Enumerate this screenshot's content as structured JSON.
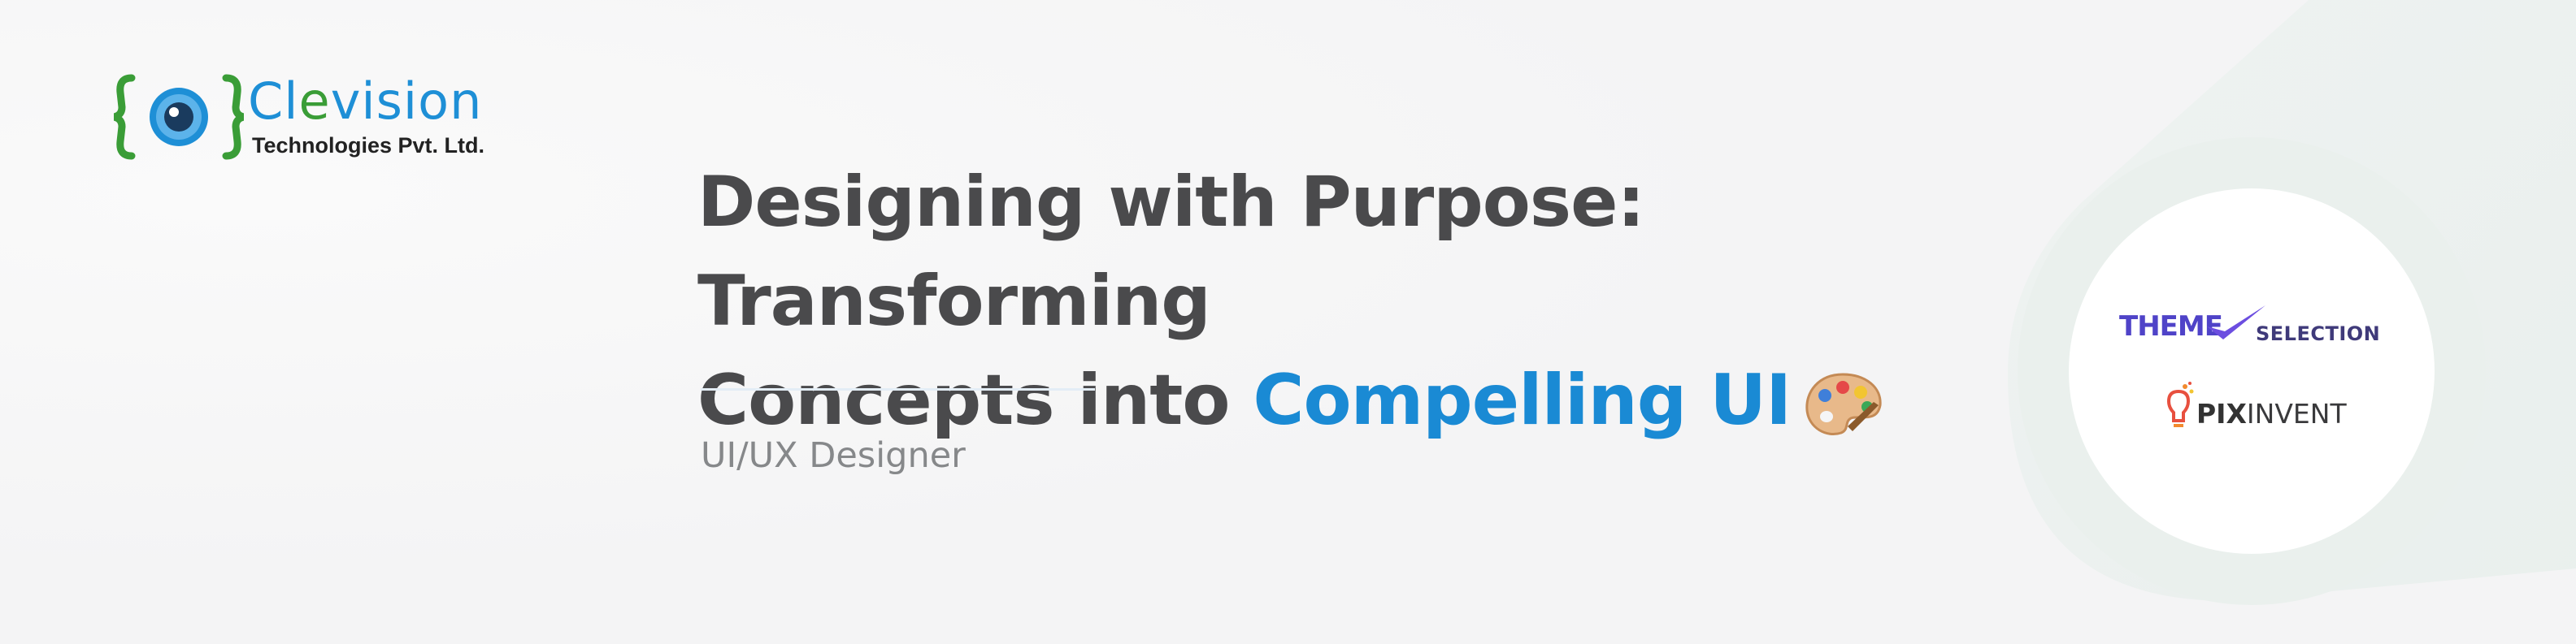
{
  "brand": {
    "name_part1": "Cl",
    "name_part2": "e",
    "name_part3": "vision",
    "subtitle": "Technologies Pvt. Ltd.",
    "brace_left": "{",
    "brace_right": "}"
  },
  "headline": {
    "line1": "Designing with Purpose: Transforming",
    "line2_plain": "Concepts into ",
    "line2_accent": "Compelling UI"
  },
  "role": "UI/UX Designer",
  "partners": {
    "theme_word": "THEME",
    "theme_sel": "SELECTION",
    "pix_bold": "PIX",
    "pix_rest": "INVENT"
  },
  "colors": {
    "accent": "#1a8ad4",
    "brand_green": "#3a9d37",
    "brand_blue": "#1e8fd6",
    "heading": "#4a4a4c",
    "muted": "#86888a",
    "theme_purple": "#4f43c8"
  },
  "icons": [
    "eye-icon",
    "artist-palette-icon",
    "checkmark-icon",
    "lightbulb-icon"
  ]
}
